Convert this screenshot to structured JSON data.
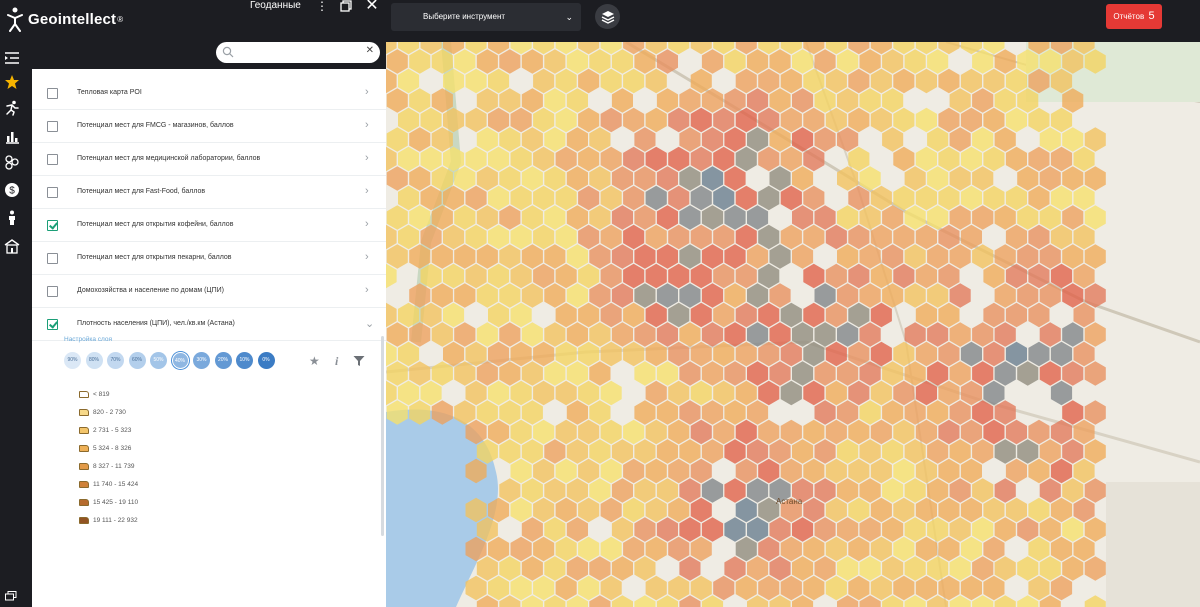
{
  "app": {
    "brand": "Geointellect",
    "brand_mark": "®",
    "panel_title": "Геоданные"
  },
  "toolbar": {
    "tool_select_label": "Выберите инструмент",
    "reports_label": "Отчётов",
    "reports_count": "5"
  },
  "search": {
    "placeholder": "",
    "value": ""
  },
  "layers": [
    {
      "label": "Тепловая карта POI",
      "checked": false
    },
    {
      "label": "Потенциал мест для FMCG - магазинов, баллов",
      "checked": false
    },
    {
      "label": "Потенциал мест для медицинской лаборатории, баллов",
      "checked": false
    },
    {
      "label": "Потенциал мест для Fast-Food, баллов",
      "checked": false
    },
    {
      "label": "Потенциал мест для открытия кофейни, баллов",
      "checked": true
    },
    {
      "label": "Потенциал мест для открытия пекарни, баллов",
      "checked": false
    },
    {
      "label": "Домохозяйства и население по домам (ЦПИ)",
      "checked": false
    },
    {
      "label": "Плотность населения (ЦПИ), чел./кв.км (Астана)",
      "checked": true
    }
  ],
  "layer_settings": {
    "title": "Настройка слоя",
    "opacity_options": [
      "90%",
      "80%",
      "70%",
      "60%",
      "50%",
      "40%",
      "30%",
      "20%",
      "10%",
      "0%"
    ],
    "selected_opacity": "40%"
  },
  "legend": [
    {
      "label": "< 819",
      "color": "#ffffff"
    },
    {
      "label": "820 - 2 730",
      "color": "#f7d98a"
    },
    {
      "label": "2 731 - 5 323",
      "color": "#f3c56b"
    },
    {
      "label": "5 324 - 8 326",
      "color": "#eeb057"
    },
    {
      "label": "8 327 - 11 739",
      "color": "#e29a48"
    },
    {
      "label": "11 740 - 15 424",
      "color": "#cf8139"
    },
    {
      "label": "15 425 - 19 110",
      "color": "#b66b2e"
    },
    {
      "label": "19 111 - 22 932",
      "color": "#925322"
    }
  ],
  "map_labels": {
    "city": "Астана"
  },
  "colors": {
    "accent": "#1b9e77",
    "reports": "#e53935",
    "topbar": "#1c1d22"
  }
}
